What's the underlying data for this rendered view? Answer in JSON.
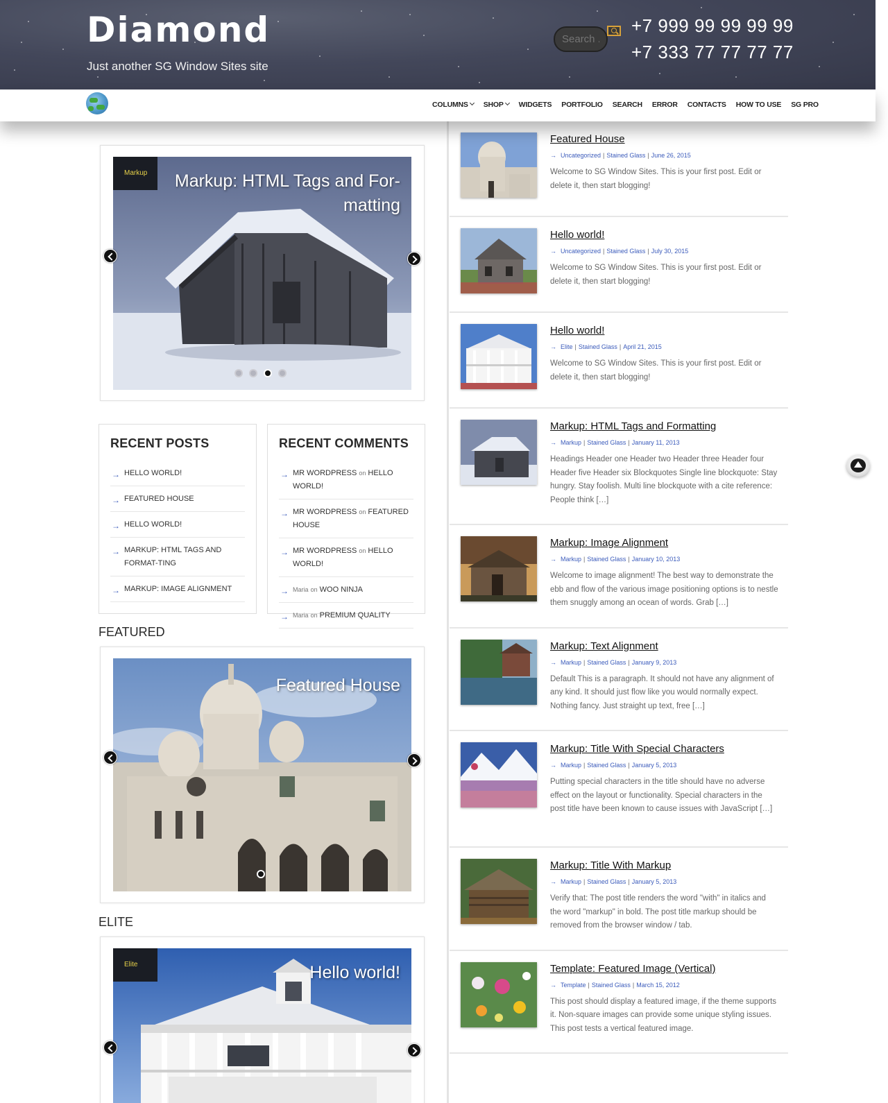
{
  "header": {
    "site_title": "Diamond",
    "tagline": "Just another SG Window Sites site",
    "search_placeholder": "Search ...",
    "phones": [
      "+7 999 99 99 99 99",
      "+7 333 77 77 77 77"
    ]
  },
  "nav": {
    "logo_icon": "recycle-globe-icon",
    "items": [
      {
        "label": "COLUMNS",
        "dropdown": true
      },
      {
        "label": "SHOP",
        "dropdown": true
      },
      {
        "label": "WIDGETS",
        "dropdown": false
      },
      {
        "label": "PORTFOLIO",
        "dropdown": false
      },
      {
        "label": "SEARCH",
        "dropdown": false
      },
      {
        "label": "ERROR",
        "dropdown": false
      },
      {
        "label": "CONTACTS",
        "dropdown": false
      },
      {
        "label": "HOW TO USE",
        "dropdown": false
      },
      {
        "label": "SG PRO",
        "dropdown": false
      }
    ]
  },
  "main_slider": {
    "category": "Markup",
    "title_line1": "Markup: HTML Tags and For-",
    "title_line2": "matting",
    "slide_count": 4,
    "active_slide": 3
  },
  "recent_posts": {
    "title": "RECENT POSTS",
    "items": [
      "HELLO WORLD!",
      "FEATURED HOUSE",
      "HELLO WORLD!",
      "MARKUP: HTML TAGS AND FORMAT-TING",
      "MARKUP: IMAGE ALIGNMENT"
    ]
  },
  "recent_comments": {
    "title": "RECENT COMMENTS",
    "on_word": "on",
    "items": [
      {
        "author": "MR WORDPRESS",
        "post": "HELLO WORLD!"
      },
      {
        "author": "MR WORDPRESS",
        "post": "FEATURED HOUSE"
      },
      {
        "author": "MR WORDPRESS",
        "post": "HELLO WORLD!"
      },
      {
        "author": "Maria",
        "post": "WOO NINJA"
      },
      {
        "author": "Maria",
        "post": "PREMIUM QUALITY"
      }
    ]
  },
  "featured": {
    "heading": "FEATURED",
    "slide_title": "Featured House"
  },
  "elite": {
    "heading": "ELITE",
    "category": "Elite",
    "slide_title": "Hello world!"
  },
  "posts": [
    {
      "title": "Featured House",
      "cats": [
        "Uncategorized",
        "Stained Glass"
      ],
      "date": "June 26, 2015",
      "excerpt": "Welcome to SG Window Sites. This is your first post. Edit or delete it, then start blogging!"
    },
    {
      "title": "Hello world!",
      "cats": [
        "Uncategorized",
        "Stained Glass"
      ],
      "date": "July 30, 2015",
      "excerpt": "Welcome to SG Window Sites. This is your first post. Edit or delete it, then start blogging!"
    },
    {
      "title": "Hello world!",
      "cats": [
        "Elite",
        "Stained Glass"
      ],
      "date": "April 21, 2015",
      "excerpt": "Welcome to SG Window Sites. This is your first post. Edit or delete it, then start blogging!"
    },
    {
      "title": "Markup: HTML Tags and Formatting",
      "cats": [
        "Markup",
        "Stained Glass"
      ],
      "date": "January 11, 2013",
      "excerpt": "Headings Header one Header two Header three Header four Header five Header six Blockquotes Single line blockquote: Stay hungry. Stay foolish. Multi line blockquote with a cite reference: People think […]"
    },
    {
      "title": "Markup: Image Alignment",
      "cats": [
        "Markup",
        "Stained Glass"
      ],
      "date": "January 10, 2013",
      "excerpt": "Welcome to image alignment! The best way to demonstrate the ebb and flow of the various image positioning options is to nestle them snuggly among an ocean of words. Grab […]"
    },
    {
      "title": "Markup: Text Alignment",
      "cats": [
        "Markup",
        "Stained Glass"
      ],
      "date": "January 9, 2013",
      "excerpt": "Default This is a paragraph. It should not have any alignment of any kind. It should just flow like you would normally expect. Nothing fancy. Just straight up text, free […]"
    },
    {
      "title": "Markup: Title With Special Characters",
      "cats": [
        "Markup",
        "Stained Glass"
      ],
      "date": "January 5, 2013",
      "excerpt": "Putting special characters in the title should have no adverse effect on the layout or functionality. Special characters in the post title have been known to cause issues with JavaScript […]"
    },
    {
      "title": "Markup: Title With Markup",
      "cats": [
        "Markup",
        "Stained Glass"
      ],
      "date": "January 5, 2013",
      "excerpt": "Verify that: The post title renders the word \"with\" in italics and the word \"markup\" in bold. The post title markup should be removed from the browser window / tab."
    },
    {
      "title": "Template: Featured Image (Vertical)",
      "cats": [
        "Template",
        "Stained Glass"
      ],
      "date": "March 15, 2012",
      "excerpt": "This post should display a featured image, if the theme supports it. Non-square images can provide some unique styling issues. This post tests a vertical featured image."
    }
  ]
}
